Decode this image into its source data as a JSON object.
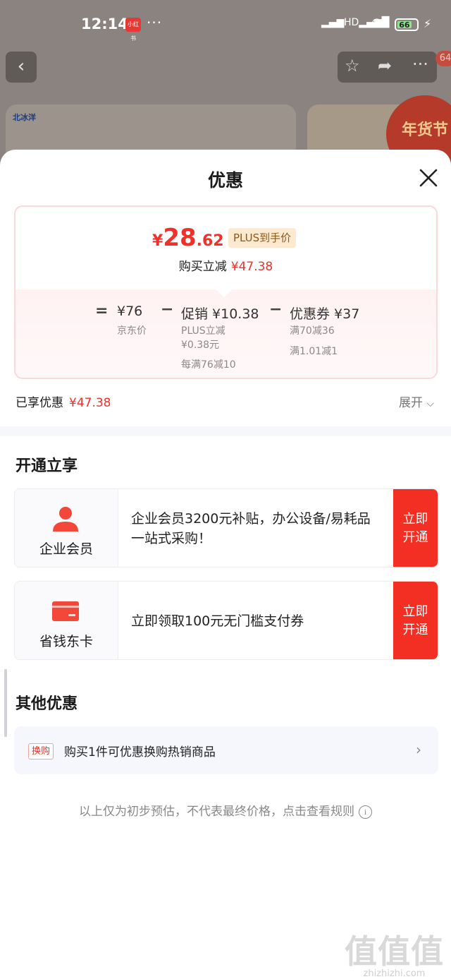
{
  "status_bar": {
    "time": "12:14",
    "app_badge": "小红书",
    "more": "···",
    "signal_a": "▂▄▆",
    "signal_b": "HD▂▄▆█",
    "battery": "66"
  },
  "nav": {
    "back": "‹",
    "star": "☆",
    "share": "➦",
    "more": "···",
    "cart_badge": "64"
  },
  "background": {
    "brand_logo": "北冰洋",
    "festival": "年货节"
  },
  "sheet": {
    "title": "优惠"
  },
  "price_card": {
    "price_currency": "¥",
    "price_int": "28",
    "price_dec": ".62",
    "plus_tag": "PLUS到手价",
    "save_label": "购买立减",
    "save_amount": "¥47.38",
    "eq": "=",
    "minus": "−",
    "base_price": "¥76",
    "base_label": "京东价",
    "promo_price": "促销 ¥10.38",
    "promo_sub1": "PLUS立减",
    "promo_sub2": "¥0.38元",
    "promo_sub3": "每满76减10",
    "coupon_price": "优惠券 ¥37",
    "coupon_sub1": "满70减36",
    "coupon_sub2": "满1.01减1"
  },
  "enjoyed": {
    "label": "已享优惠",
    "amount": "¥47.38",
    "expand": "展开"
  },
  "open_section": {
    "title": "开通立享",
    "cards": [
      {
        "name": "企业会员",
        "desc": "企业会员3200元补贴，办公设备/易耗品一站式采购！",
        "btn": "立即开通",
        "btn_l1": "立即",
        "btn_l2": "开通"
      },
      {
        "name": "省钱东卡",
        "desc": "立即领取100元无门槛支付券",
        "btn": "立即开通",
        "btn_l1": "立即",
        "btn_l2": "开通"
      }
    ]
  },
  "other_section": {
    "title": "其他优惠",
    "tag": "换购",
    "text": "购买1件可优惠换购热销商品"
  },
  "footer": {
    "note": "以上仅为初步预估，不代表最终价格，点击查看规则",
    "info_icon": "i"
  },
  "watermark": {
    "mark": "值值值",
    "text": "zhizhizhi.com"
  },
  "colors": {
    "accent_red": "#f0302a",
    "button_red": "#f22f22",
    "plus_bg": "#fde9cf"
  }
}
